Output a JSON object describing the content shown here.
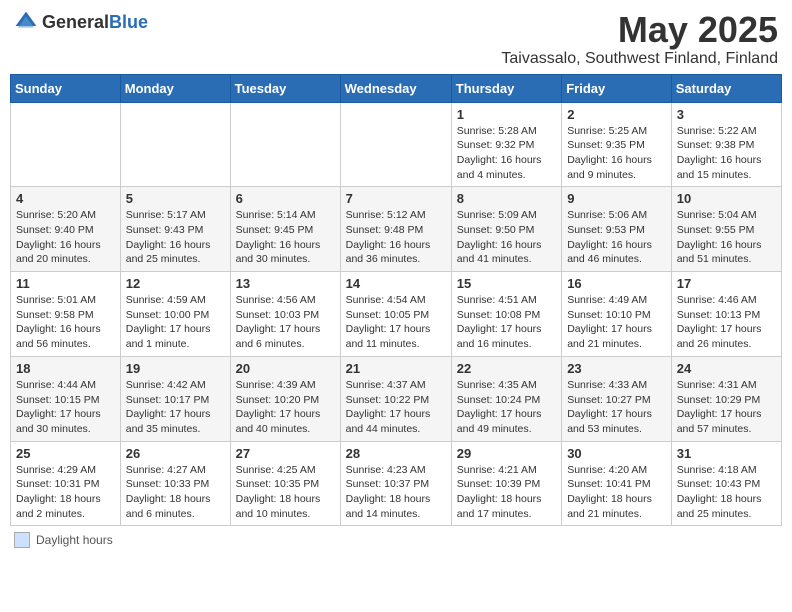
{
  "header": {
    "logo_general": "General",
    "logo_blue": "Blue",
    "month": "May 2025",
    "location": "Taivassalo, Southwest Finland, Finland"
  },
  "weekdays": [
    "Sunday",
    "Monday",
    "Tuesday",
    "Wednesday",
    "Thursday",
    "Friday",
    "Saturday"
  ],
  "footer": {
    "legend_label": "Daylight hours"
  },
  "weeks": [
    [
      {
        "day": "",
        "info": ""
      },
      {
        "day": "",
        "info": ""
      },
      {
        "day": "",
        "info": ""
      },
      {
        "day": "",
        "info": ""
      },
      {
        "day": "1",
        "info": "Sunrise: 5:28 AM\nSunset: 9:32 PM\nDaylight: 16 hours\nand 4 minutes."
      },
      {
        "day": "2",
        "info": "Sunrise: 5:25 AM\nSunset: 9:35 PM\nDaylight: 16 hours\nand 9 minutes."
      },
      {
        "day": "3",
        "info": "Sunrise: 5:22 AM\nSunset: 9:38 PM\nDaylight: 16 hours\nand 15 minutes."
      }
    ],
    [
      {
        "day": "4",
        "info": "Sunrise: 5:20 AM\nSunset: 9:40 PM\nDaylight: 16 hours\nand 20 minutes."
      },
      {
        "day": "5",
        "info": "Sunrise: 5:17 AM\nSunset: 9:43 PM\nDaylight: 16 hours\nand 25 minutes."
      },
      {
        "day": "6",
        "info": "Sunrise: 5:14 AM\nSunset: 9:45 PM\nDaylight: 16 hours\nand 30 minutes."
      },
      {
        "day": "7",
        "info": "Sunrise: 5:12 AM\nSunset: 9:48 PM\nDaylight: 16 hours\nand 36 minutes."
      },
      {
        "day": "8",
        "info": "Sunrise: 5:09 AM\nSunset: 9:50 PM\nDaylight: 16 hours\nand 41 minutes."
      },
      {
        "day": "9",
        "info": "Sunrise: 5:06 AM\nSunset: 9:53 PM\nDaylight: 16 hours\nand 46 minutes."
      },
      {
        "day": "10",
        "info": "Sunrise: 5:04 AM\nSunset: 9:55 PM\nDaylight: 16 hours\nand 51 minutes."
      }
    ],
    [
      {
        "day": "11",
        "info": "Sunrise: 5:01 AM\nSunset: 9:58 PM\nDaylight: 16 hours\nand 56 minutes."
      },
      {
        "day": "12",
        "info": "Sunrise: 4:59 AM\nSunset: 10:00 PM\nDaylight: 17 hours\nand 1 minute."
      },
      {
        "day": "13",
        "info": "Sunrise: 4:56 AM\nSunset: 10:03 PM\nDaylight: 17 hours\nand 6 minutes."
      },
      {
        "day": "14",
        "info": "Sunrise: 4:54 AM\nSunset: 10:05 PM\nDaylight: 17 hours\nand 11 minutes."
      },
      {
        "day": "15",
        "info": "Sunrise: 4:51 AM\nSunset: 10:08 PM\nDaylight: 17 hours\nand 16 minutes."
      },
      {
        "day": "16",
        "info": "Sunrise: 4:49 AM\nSunset: 10:10 PM\nDaylight: 17 hours\nand 21 minutes."
      },
      {
        "day": "17",
        "info": "Sunrise: 4:46 AM\nSunset: 10:13 PM\nDaylight: 17 hours\nand 26 minutes."
      }
    ],
    [
      {
        "day": "18",
        "info": "Sunrise: 4:44 AM\nSunset: 10:15 PM\nDaylight: 17 hours\nand 30 minutes."
      },
      {
        "day": "19",
        "info": "Sunrise: 4:42 AM\nSunset: 10:17 PM\nDaylight: 17 hours\nand 35 minutes."
      },
      {
        "day": "20",
        "info": "Sunrise: 4:39 AM\nSunset: 10:20 PM\nDaylight: 17 hours\nand 40 minutes."
      },
      {
        "day": "21",
        "info": "Sunrise: 4:37 AM\nSunset: 10:22 PM\nDaylight: 17 hours\nand 44 minutes."
      },
      {
        "day": "22",
        "info": "Sunrise: 4:35 AM\nSunset: 10:24 PM\nDaylight: 17 hours\nand 49 minutes."
      },
      {
        "day": "23",
        "info": "Sunrise: 4:33 AM\nSunset: 10:27 PM\nDaylight: 17 hours\nand 53 minutes."
      },
      {
        "day": "24",
        "info": "Sunrise: 4:31 AM\nSunset: 10:29 PM\nDaylight: 17 hours\nand 57 minutes."
      }
    ],
    [
      {
        "day": "25",
        "info": "Sunrise: 4:29 AM\nSunset: 10:31 PM\nDaylight: 18 hours\nand 2 minutes."
      },
      {
        "day": "26",
        "info": "Sunrise: 4:27 AM\nSunset: 10:33 PM\nDaylight: 18 hours\nand 6 minutes."
      },
      {
        "day": "27",
        "info": "Sunrise: 4:25 AM\nSunset: 10:35 PM\nDaylight: 18 hours\nand 10 minutes."
      },
      {
        "day": "28",
        "info": "Sunrise: 4:23 AM\nSunset: 10:37 PM\nDaylight: 18 hours\nand 14 minutes."
      },
      {
        "day": "29",
        "info": "Sunrise: 4:21 AM\nSunset: 10:39 PM\nDaylight: 18 hours\nand 17 minutes."
      },
      {
        "day": "30",
        "info": "Sunrise: 4:20 AM\nSunset: 10:41 PM\nDaylight: 18 hours\nand 21 minutes."
      },
      {
        "day": "31",
        "info": "Sunrise: 4:18 AM\nSunset: 10:43 PM\nDaylight: 18 hours\nand 25 minutes."
      }
    ]
  ]
}
